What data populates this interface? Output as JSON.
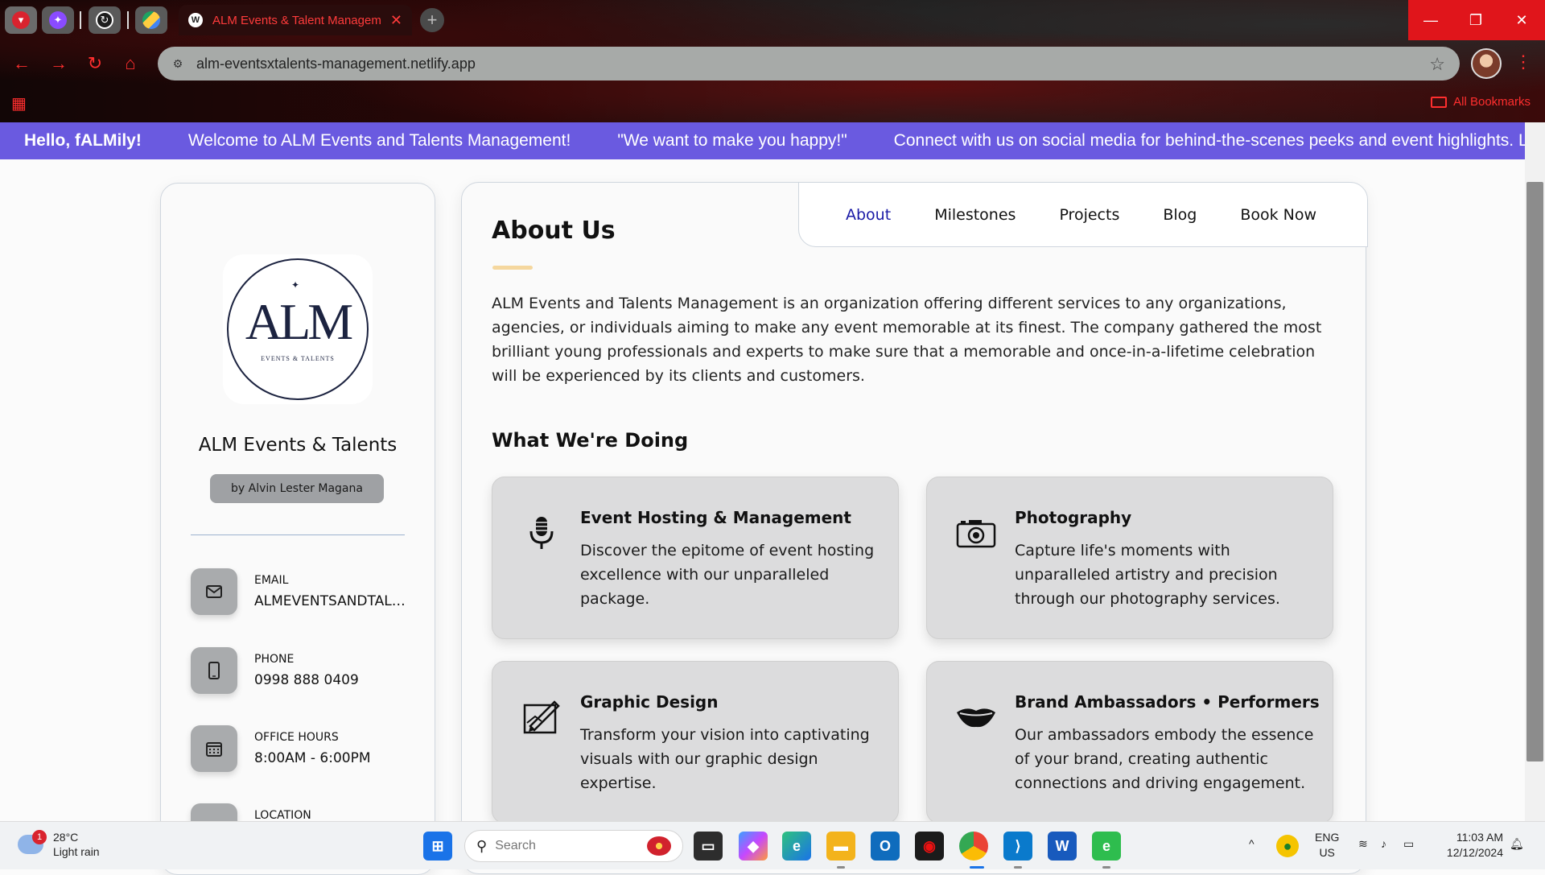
{
  "browser": {
    "active_tab_title": "ALM Events & Talent Management",
    "active_tab_favicon": "W",
    "url": "alm-eventsxtalents-management.netlify.app",
    "all_bookmarks": "All Bookmarks",
    "accent_color": "#ff2e2e"
  },
  "marquee": {
    "greeting": "Hello, fALMily!",
    "items": [
      "Welcome to ALM Events and Talents Management!",
      "\"We want to make you happy!\"",
      "Connect with us on social media for behind-the-scenes peeks and event highlights. Let's crea"
    ],
    "background": "#6a5ae0"
  },
  "sidebar": {
    "logo_mark": "ALM",
    "logo_sub": "EVENTS & TALENTS",
    "brand_name": "ALM Events & Talents",
    "byline": "by Alvin Lester Magana",
    "contacts": [
      {
        "label": "EMAIL",
        "value": "ALMEVENTSANDTALENTS",
        "icon": "mail-icon"
      },
      {
        "label": "PHONE",
        "value": "0998 888 0409",
        "icon": "phone-icon"
      },
      {
        "label": "OFFICE HOURS",
        "value": "8:00AM - 6:00PM",
        "icon": "calendar-icon"
      },
      {
        "label": "LOCATION",
        "value": "",
        "icon": "location-icon"
      }
    ]
  },
  "nav": {
    "items": [
      "About",
      "Milestones",
      "Projects",
      "Blog",
      "Book Now"
    ],
    "active": "About",
    "active_color": "#1a1aa6"
  },
  "about": {
    "title": "About Us",
    "body": "ALM Events and Talents Management is an organization offering different services to any organizations, agencies, or individuals aiming to make any event memorable at its finest. The company gathered the most brilliant young professionals and experts to make sure that a memorable and once-in-a-lifetime celebration will be experienced by its clients and customers.",
    "doing_title": "What We're Doing",
    "services": [
      {
        "title": "Event Hosting & Management",
        "desc": "Discover the epitome of event hosting excellence with our unparalleled package.",
        "icon": "microphone-icon"
      },
      {
        "title": "Photography",
        "desc": "Capture life's moments with unparalleled artistry and precision through our photography services.",
        "icon": "camera-icon"
      },
      {
        "title": "Graphic Design",
        "desc": "Transform your vision into captivating visuals with our graphic design expertise.",
        "icon": "design-icon"
      },
      {
        "title": "Brand Ambassadors • Performers",
        "desc": "Our ambassadors embody the essence of your brand, creating authentic connections and driving engagement.",
        "icon": "lips-icon"
      }
    ]
  },
  "taskbar": {
    "weather_badge": "1",
    "temperature": "28°C",
    "condition": "Light rain",
    "search_placeholder": "Search",
    "lang_top": "ENG",
    "lang_bottom": "US",
    "time": "11:03 AM",
    "date": "12/12/2024"
  }
}
